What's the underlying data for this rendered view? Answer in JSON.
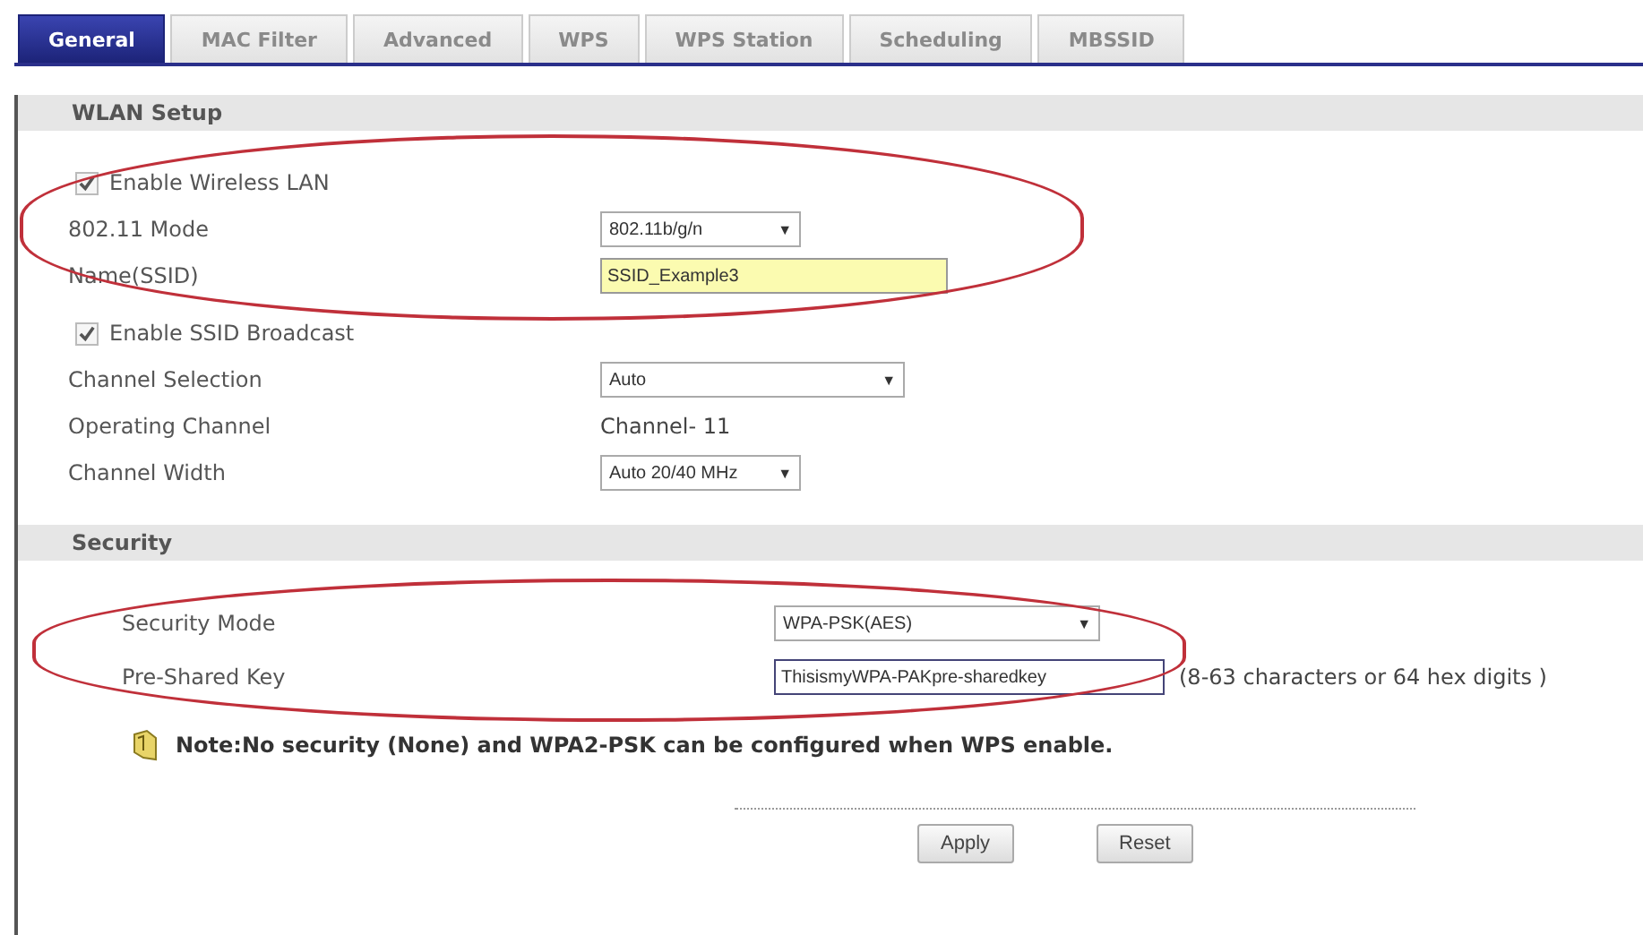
{
  "tabs": [
    {
      "label": "General",
      "selected": true
    },
    {
      "label": "MAC Filter",
      "selected": false
    },
    {
      "label": "Advanced",
      "selected": false
    },
    {
      "label": "WPS",
      "selected": false
    },
    {
      "label": "WPS Station",
      "selected": false
    },
    {
      "label": "Scheduling",
      "selected": false
    },
    {
      "label": "MBSSID",
      "selected": false
    }
  ],
  "wlan_setup": {
    "title": "WLAN Setup",
    "circled_rows": [
      {
        "kind": "checkbox",
        "label": "Enable Wireless LAN",
        "checked": true
      },
      {
        "kind": "select",
        "label": "802.11 Mode",
        "value": "802.11b/g/n",
        "caret": "▼"
      },
      {
        "kind": "input",
        "label": "Name(SSID)",
        "value": "SSID_Example3"
      }
    ],
    "rows": [
      {
        "kind": "checkbox",
        "label": "Enable SSID Broadcast",
        "checked": true
      },
      {
        "kind": "select",
        "label": "Channel Selection",
        "value": "Auto",
        "caret": "▼"
      },
      {
        "kind": "text",
        "label": "Operating Channel",
        "value": "Channel- 11"
      },
      {
        "kind": "select",
        "label": "Channel Width",
        "value": "Auto 20/40 MHz",
        "caret": "▼"
      }
    ]
  },
  "security": {
    "title": "Security",
    "circled_rows": [
      {
        "kind": "select",
        "label": "Security Mode",
        "value": "WPA-PSK(AES)",
        "caret": "▼"
      },
      {
        "kind": "input",
        "label": "Pre-Shared Key",
        "value": "ThisismyWPA-PAKpre-sharedkey",
        "hint": "(8-63 characters or 64 hex digits )"
      }
    ],
    "note": "Note:No security (None) and WPA2-PSK can be configured when WPS enable."
  },
  "buttons": [
    "Apply",
    "Reset"
  ]
}
